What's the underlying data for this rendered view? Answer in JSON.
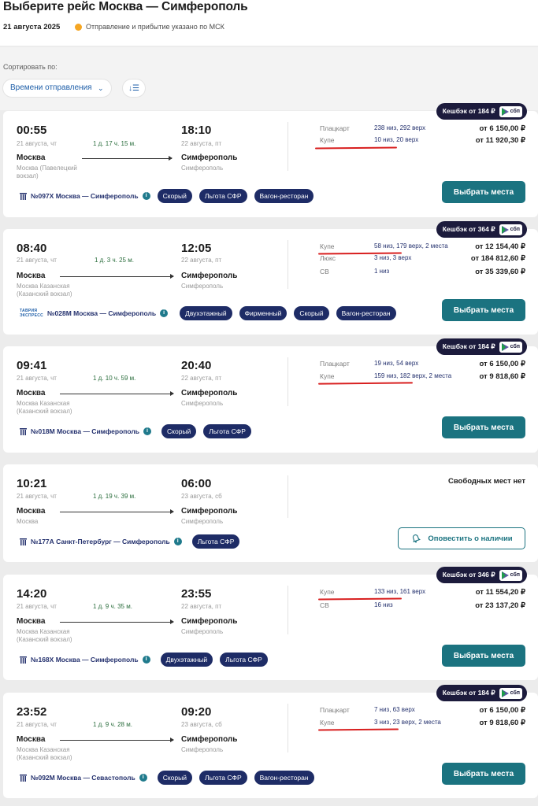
{
  "header": {
    "title": "Выберите рейс Москва — Симферополь",
    "date": "21 августа 2025",
    "tz_note": "Отправление и прибытие указано по МСК"
  },
  "sort": {
    "label": "Сортировать по:",
    "selected": "Времени отправления"
  },
  "sbp_label": "сбп",
  "trains": [
    {
      "cashback": "Кешбэк от 184 ₽",
      "dep_time": "00:55",
      "dep_date": "21 августа, чт",
      "duration": "1 д. 17 ч. 15 м.",
      "arr_time": "18:10",
      "arr_date": "22 августа, пт",
      "from_city": "Москва",
      "from_station": "Москва (Павелецкий вокзал)",
      "to_city": "Симферополь",
      "to_station": "Симферополь",
      "number": "№097Х Москва — Симферополь",
      "tags": [
        "Скорый",
        "Льгота СФР",
        "Вагон-ресторан"
      ],
      "seats": [
        {
          "cls": "Плацкарт",
          "avail": "238 низ, 292 верх",
          "price": "от 6 150,00 ₽"
        },
        {
          "cls": "Купе",
          "avail": "10 низ, 20 верх",
          "price": "от 11 920,30 ₽"
        }
      ],
      "action": "Выбрать места"
    },
    {
      "cashback": "Кешбэк от 364 ₽",
      "dep_time": "08:40",
      "dep_date": "21 августа, чт",
      "duration": "1 д. 3 ч. 25 м.",
      "arr_time": "12:05",
      "arr_date": "22 августа, пт",
      "from_city": "Москва",
      "from_station": "Москва Казанская (Казанский вокзал)",
      "to_city": "Симферополь",
      "to_station": "Симферополь",
      "carrier_top": "ТАВРИЯ",
      "carrier_bottom": "ЭКСПРЕСС",
      "number": "№028М Москва — Симферополь",
      "tags": [
        "Двухэтажный",
        "Фирменный",
        "Скорый",
        "Вагон-ресторан"
      ],
      "seats": [
        {
          "cls": "Купе",
          "avail": "58 низ, 179 верх, 2 места",
          "price": "от 12 154,40 ₽"
        },
        {
          "cls": "Люкс",
          "avail": "3 низ, 3 верх",
          "price": "от 184 812,60 ₽"
        },
        {
          "cls": "СВ",
          "avail": "1 низ",
          "price": "от 35 339,60 ₽"
        }
      ],
      "action": "Выбрать места"
    },
    {
      "cashback": "Кешбэк от 184 ₽",
      "dep_time": "09:41",
      "dep_date": "21 августа, чт",
      "duration": "1 д. 10 ч. 59 м.",
      "arr_time": "20:40",
      "arr_date": "22 августа, пт",
      "from_city": "Москва",
      "from_station": "Москва Казанская (Казанский вокзал)",
      "to_city": "Симферополь",
      "to_station": "Симферополь",
      "number": "№018М Москва — Симферополь",
      "tags": [
        "Скорый",
        "Льгота СФР"
      ],
      "seats": [
        {
          "cls": "Плацкарт",
          "avail": "19 низ, 54 верх",
          "price": "от 6 150,00 ₽"
        },
        {
          "cls": "Купе",
          "avail": "159 низ, 182 верх, 2 места",
          "price": "от 9 818,60 ₽"
        }
      ],
      "action": "Выбрать места"
    },
    {
      "dep_time": "10:21",
      "dep_date": "21 августа, чт",
      "duration": "1 д. 19 ч. 39 м.",
      "arr_time": "06:00",
      "arr_date": "23 августа, сб",
      "from_city": "Москва",
      "from_station": "Москва",
      "to_city": "Симферополь",
      "to_station": "Симферополь",
      "number": "№177А Санкт-Петербург — Симферополь",
      "tags": [
        "Льгота СФР"
      ],
      "no_seats": "Свободных мест нет",
      "action": "Оповестить о наличии"
    },
    {
      "cashback": "Кешбэк от 346 ₽",
      "dep_time": "14:20",
      "dep_date": "21 августа, чт",
      "duration": "1 д. 9 ч. 35 м.",
      "arr_time": "23:55",
      "arr_date": "22 августа, пт",
      "from_city": "Москва",
      "from_station": "Москва Казанская (Казанский вокзал)",
      "to_city": "Симферополь",
      "to_station": "Симферополь",
      "number": "№168Х Москва — Симферополь",
      "tags": [
        "Двухэтажный",
        "Льгота СФР"
      ],
      "seats": [
        {
          "cls": "Купе",
          "avail": "133 низ, 161 верх",
          "price": "от 11 554,20 ₽"
        },
        {
          "cls": "СВ",
          "avail": "16 низ",
          "price": "от 23 137,20 ₽"
        }
      ],
      "action": "Выбрать места"
    },
    {
      "cashback": "Кешбэк от 184 ₽",
      "dep_time": "23:52",
      "dep_date": "21 августа, чт",
      "duration": "1 д. 9 ч. 28 м.",
      "arr_time": "09:20",
      "arr_date": "23 августа, сб",
      "from_city": "Москва",
      "from_station": "Москва Казанская (Казанский вокзал)",
      "to_city": "Симферополь",
      "to_station": "Симферополь",
      "number": "№092М Москва — Севастополь",
      "tags": [
        "Скорый",
        "Льгота СФР",
        "Вагон-ресторан"
      ],
      "seats": [
        {
          "cls": "Плацкарт",
          "avail": "7 низ, 63 верх",
          "price": "от 6 150,00 ₽"
        },
        {
          "cls": "Купе",
          "avail": "3 низ, 23 верх, 2 места",
          "price": "от 9 818,60 ₽"
        }
      ],
      "action": "Выбрать места"
    }
  ]
}
